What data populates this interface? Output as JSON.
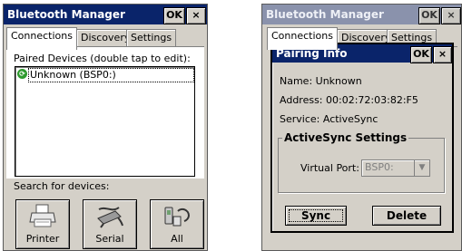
{
  "left": {
    "window": {
      "title": "Bluetooth Manager",
      "ok_label": "OK",
      "close_label": "×"
    },
    "tabs": [
      {
        "label": "Connections"
      },
      {
        "label": "Discovery"
      },
      {
        "label": "Settings"
      }
    ],
    "paired_label": "Paired Devices (double tap to edit):",
    "paired_devices": [
      {
        "name": "Unknown (BSP0:)",
        "icon": "bluetooth-device-icon"
      }
    ],
    "search_label": "Search for devices:",
    "device_buttons": [
      {
        "label": "Printer",
        "icon": "printer-icon"
      },
      {
        "label": "Serial",
        "icon": "serial-cable-icon"
      },
      {
        "label": "All",
        "icon": "all-devices-icon"
      }
    ]
  },
  "right": {
    "window": {
      "title": "Bluetooth Manager",
      "ok_label": "OK",
      "close_label": "×"
    },
    "tabs": [
      {
        "label": "Connections"
      },
      {
        "label": "Discovery"
      },
      {
        "label": "Settings"
      }
    ],
    "dialog": {
      "title": "Pairing Info",
      "ok_label": "OK",
      "close_label": "×",
      "name_line": "Name:  Unknown",
      "address_line": "Address: 00:02:72:03:82:F5",
      "service_line": "Service:  ActiveSync",
      "group_title": "ActiveSync Settings",
      "virtual_port_label": "Virtual Port:",
      "virtual_port_value": "BSP0:",
      "sync_label": "Sync",
      "delete_label": "Delete"
    }
  },
  "colors": {
    "title_active": "#0a246a",
    "title_inactive": "#8a92ac",
    "face": "#d4d0c8",
    "bt_green": "#2e9a2e"
  }
}
